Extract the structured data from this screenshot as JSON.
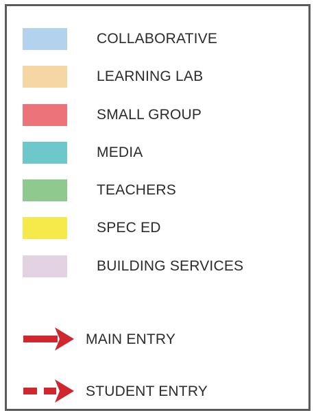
{
  "legend": {
    "categories": [
      {
        "label": "COLLABORATIVE",
        "color": "#b3d2ed"
      },
      {
        "label": "LEARNING LAB",
        "color": "#f6d6a2"
      },
      {
        "label": "SMALL GROUP",
        "color": "#ec737a"
      },
      {
        "label": "MEDIA",
        "color": "#6cc8cb"
      },
      {
        "label": "TEACHERS",
        "color": "#8fc98e"
      },
      {
        "label": "SPEC ED",
        "color": "#f6e94a"
      },
      {
        "label": "BUILDING SERVICES",
        "color": "#e2d2e2"
      }
    ],
    "entries": [
      {
        "label": "MAIN ENTRY",
        "icon": "solid-arrow-icon",
        "color": "#d0262d"
      },
      {
        "label": "STUDENT ENTRY",
        "icon": "dashed-arrow-icon",
        "color": "#d0262d"
      }
    ]
  }
}
